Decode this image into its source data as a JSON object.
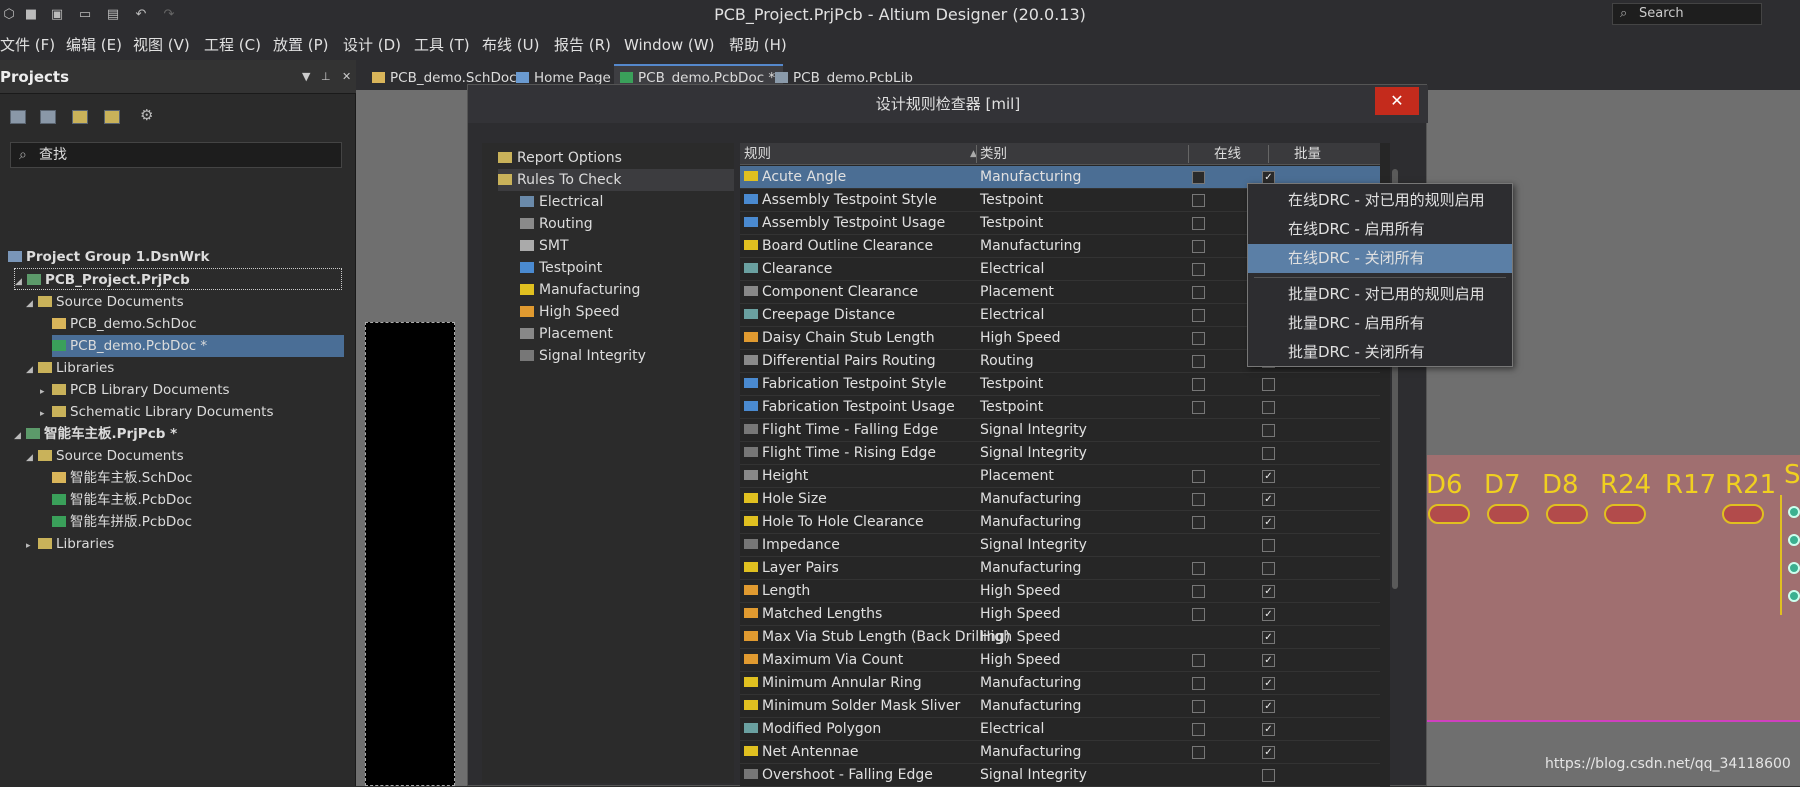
{
  "app": {
    "title": "PCB_Project.PrjPcb - Altium Designer (20.0.13)",
    "search_placeholder": "Search"
  },
  "menu": [
    "文件 (F)",
    "编辑 (E)",
    "视图 (V)",
    "工程 (C)",
    "放置 (P)",
    "设计 (D)",
    "工具 (T)",
    "布线 (U)",
    "报告 (R)",
    "Window (W)",
    "帮助 (H)"
  ],
  "panel": {
    "title": "Projects",
    "find_placeholder": "查找",
    "tree": [
      {
        "label": "Project Group 1.DsnWrk"
      },
      {
        "label": "PCB_Project.PrjPcb"
      },
      {
        "label": "Source Documents"
      },
      {
        "label": "PCB_demo.SchDoc"
      },
      {
        "label": "PCB_demo.PcbDoc *"
      },
      {
        "label": "Libraries"
      },
      {
        "label": "PCB Library Documents"
      },
      {
        "label": "Schematic Library Documents"
      },
      {
        "label": "智能车主板.PrjPcb *"
      },
      {
        "label": "Source Documents"
      },
      {
        "label": "智能车主板.SchDoc"
      },
      {
        "label": "智能车主板.PcbDoc"
      },
      {
        "label": "智能车拼版.PcbDoc"
      },
      {
        "label": "Libraries"
      }
    ]
  },
  "tabs": [
    "PCB_demo.SchDoc",
    "Home Page",
    "PCB_demo.PcbDoc *",
    "PCB_demo.PcbLib"
  ],
  "pcb": {
    "designators": [
      "D6",
      "D7",
      "D8",
      "R24",
      "R17",
      "R21",
      "S"
    ]
  },
  "dialog": {
    "title": "设计规则检查器 [mil]",
    "close": "✕",
    "left": [
      "Report Options",
      "Rules To Check",
      "Electrical",
      "Routing",
      "SMT",
      "Testpoint",
      "Manufacturing",
      "High Speed",
      "Placement",
      "Signal Integrity"
    ],
    "columns": {
      "rule": "规则",
      "category": "类别",
      "online": "在线",
      "batch": "批量"
    },
    "rules": [
      {
        "name": "Acute Angle",
        "cat": "Manufacturing",
        "on": "",
        "batch": "✓"
      },
      {
        "name": "Assembly Testpoint Style",
        "cat": "Testpoint",
        "on": "",
        "batch": ""
      },
      {
        "name": "Assembly Testpoint Usage",
        "cat": "Testpoint",
        "on": "",
        "batch": ""
      },
      {
        "name": "Board Outline Clearance",
        "cat": "Manufacturing",
        "on": "",
        "batch": ""
      },
      {
        "name": "Clearance",
        "cat": "Electrical",
        "on": "",
        "batch": ""
      },
      {
        "name": "Component Clearance",
        "cat": "Placement",
        "on": "",
        "batch": ""
      },
      {
        "name": "Creepage Distance",
        "cat": "Electrical",
        "on": "",
        "batch": ""
      },
      {
        "name": "Daisy Chain Stub Length",
        "cat": "High Speed",
        "on": "",
        "batch": ""
      },
      {
        "name": "Differential Pairs Routing",
        "cat": "Routing",
        "on": "",
        "batch": ""
      },
      {
        "name": "Fabrication Testpoint Style",
        "cat": "Testpoint",
        "on": "",
        "batch": ""
      },
      {
        "name": "Fabrication Testpoint Usage",
        "cat": "Testpoint",
        "on": "",
        "batch": ""
      },
      {
        "name": "Flight Time - Falling Edge",
        "cat": "Signal Integrity",
        "on": "-",
        "batch": ""
      },
      {
        "name": "Flight Time - Rising Edge",
        "cat": "Signal Integrity",
        "on": "-",
        "batch": ""
      },
      {
        "name": "Height",
        "cat": "Placement",
        "on": "",
        "batch": "✓"
      },
      {
        "name": "Hole Size",
        "cat": "Manufacturing",
        "on": "",
        "batch": "✓"
      },
      {
        "name": "Hole To Hole Clearance",
        "cat": "Manufacturing",
        "on": "",
        "batch": "✓"
      },
      {
        "name": "Impedance",
        "cat": "Signal Integrity",
        "on": "-",
        "batch": ""
      },
      {
        "name": "Layer Pairs",
        "cat": "Manufacturing",
        "on": "",
        "batch": ""
      },
      {
        "name": "Length",
        "cat": "High Speed",
        "on": "",
        "batch": "✓"
      },
      {
        "name": "Matched Lengths",
        "cat": "High Speed",
        "on": "",
        "batch": "✓"
      },
      {
        "name": "Max Via Stub Length (Back Drilling)",
        "cat": "High Speed",
        "on": "-",
        "batch": "✓"
      },
      {
        "name": "Maximum Via Count",
        "cat": "High Speed",
        "on": "",
        "batch": "✓"
      },
      {
        "name": "Minimum Annular Ring",
        "cat": "Manufacturing",
        "on": "",
        "batch": "✓"
      },
      {
        "name": "Minimum Solder Mask Sliver",
        "cat": "Manufacturing",
        "on": "",
        "batch": "✓"
      },
      {
        "name": "Modified Polygon",
        "cat": "Electrical",
        "on": "",
        "batch": "✓"
      },
      {
        "name": "Net Antennae",
        "cat": "Manufacturing",
        "on": "",
        "batch": "✓"
      },
      {
        "name": "Overshoot - Falling Edge",
        "cat": "Signal Integrity",
        "on": "-",
        "batch": ""
      }
    ]
  },
  "context_menu": [
    "在线DRC - 对已用的规则启用",
    "在线DRC - 启用所有",
    "在线DRC - 关闭所有",
    "批量DRC - 对已用的规则启用",
    "批量DRC - 启用所有",
    "批量DRC - 关闭所有"
  ],
  "watermark": "https://blog.csdn.net/qq_34118600"
}
